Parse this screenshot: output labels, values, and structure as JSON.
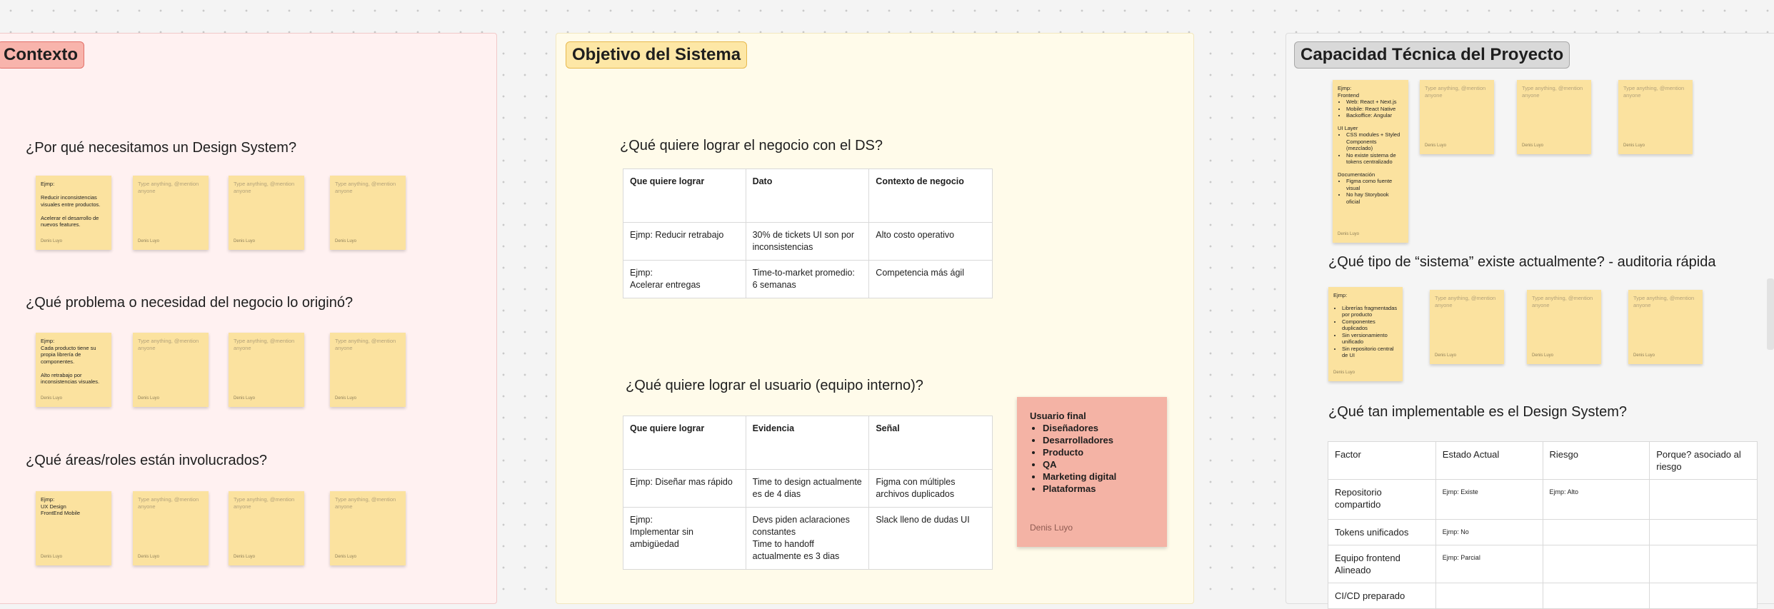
{
  "sections": {
    "contexto": {
      "title": "Contexto",
      "bg": "#fff1f1",
      "border": "#f1c9c9",
      "title_bg": "#f8b4ac",
      "title_border": "#e2716a"
    },
    "objetivo": {
      "title": "Objetivo del Sistema",
      "bg": "#fffbea",
      "border": "#f2e7bf",
      "title_bg": "#fde7a6",
      "title_border": "#e7b94f"
    },
    "capacidad": {
      "title": "Capacidad Técnica del Proyecto",
      "bg": "#f5f5f5",
      "border": "#dddddd",
      "title_bg": "#d9d9d9",
      "title_border": "#a8a8a8"
    }
  },
  "contexto": {
    "q1": "¿Por qué necesitamos un Design System?",
    "q1_sticky": {
      "text": "Ejmp:\n\nReducir inconsistencias visuales entre productos.\n\nAcelerar el desarrollo de nuevos features.",
      "author": "Denis Luyo"
    },
    "q2": "¿Qué problema o necesidad del negocio lo originó?",
    "q2_sticky": {
      "text": "Ejmp:\nCada producto tiene su propia librería de componentes.\n\nAlto retrabajo por inconsistencias visuales.",
      "author": "Denis Luyo"
    },
    "q3": "¿Qué áreas/roles están involucrados?",
    "q3_sticky": {
      "text": "Ejmp:\nUX Design\nFrontEnd Mobile",
      "author": "Denis Luyo"
    }
  },
  "placeholder": {
    "text": "Type anything, @mention anyone",
    "author": "Denis Luyo"
  },
  "objetivo": {
    "q1": "¿Qué quiere lograr el negocio con el DS?",
    "table1": {
      "headers": [
        "Que quiere lograr",
        "Dato",
        "Contexto de negocio"
      ],
      "rows": [
        [
          "Ejmp: Reducir retrabajo",
          "30% de tickets UI son por inconsistencias",
          "Alto costo operativo"
        ],
        [
          "Ejmp:\nAcelerar entregas",
          "Time-to-market promedio: 6 semanas",
          "Competencia más ágil"
        ]
      ]
    },
    "q2": "¿Qué quiere lograr el usuario (equipo interno)?",
    "table2": {
      "headers": [
        "Que quiere lograr",
        "Evidencia",
        "Señal"
      ],
      "rows": [
        [
          "Ejmp: Diseñar mas rápido",
          "Time to design actualmente es de 4 dias",
          "Figma con múltiples archivos duplicados"
        ],
        [
          "Ejmp:\nImplementar sin ambigüedad",
          "Devs piden aclaraciones constantes\nTime to handoff actualmente es 3 dias",
          "Slack lleno de dudas UI"
        ]
      ]
    },
    "note": {
      "title": "Usuario final",
      "items": [
        "Diseñadores",
        "Desarrolladores",
        "Producto",
        "QA",
        "Marketing digital",
        "Plataformas"
      ],
      "author": "Denis Luyo"
    }
  },
  "capacidad": {
    "stack_sticky": {
      "label": "Ejmp:",
      "frontend_label": "Frontend",
      "frontend_items": [
        "Web: React + Next.js",
        "Mobile: React Native",
        "Backoffice: Angular"
      ],
      "ui_label": "UI Layer",
      "ui_items": [
        "CSS modules + Styled Components (mezclado)",
        "No existe sistema de tokens centralizado"
      ],
      "doc_label": "Documentación",
      "doc_items": [
        "Figma como fuente visual",
        "No hay Storybook oficial"
      ],
      "author": "Denis Luyo"
    },
    "q2": "¿Qué tipo de “sistema” existe actualmente?  - auditoria rápida",
    "audit_sticky": {
      "label": "Ejmp:",
      "items": [
        "Librerías fragmentadas por producto",
        "Componentes duplicados",
        "Sin versionamiento unificado",
        "Sin repositorio central de UI"
      ],
      "author": "Denis Luyo"
    },
    "q3": "¿Qué tan implementable es el Design System?",
    "table3": {
      "headers": [
        "Factor",
        "Estado Actual",
        "Riesgo",
        "Porque? asociado al riesgo"
      ],
      "rows": [
        [
          "Repositorio compartido",
          "Ejmp: Existe",
          "Ejmp: Alto",
          ""
        ],
        [
          "Tokens unificados",
          "Ejmp: No",
          "",
          ""
        ],
        [
          "Equipo frontend Alineado",
          "Ejmp: Parcial",
          "",
          ""
        ],
        [
          "CI/CD preparado",
          "",
          "",
          ""
        ]
      ]
    }
  }
}
